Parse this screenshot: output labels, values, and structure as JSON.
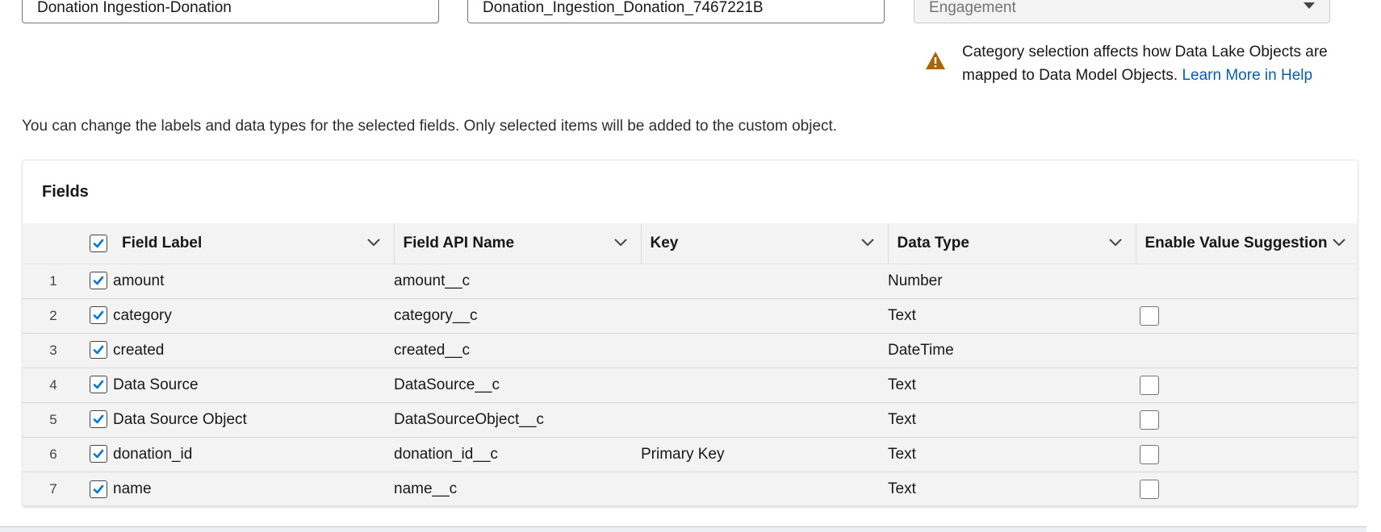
{
  "form": {
    "object_label_value": "Donation Ingestion-Donation",
    "object_api_name_value": "Donation_Ingestion_Donation_7467221B",
    "category_value": "Engagement"
  },
  "warning": {
    "text": "Category selection affects how Data Lake Objects are mapped to Data Model Objects.",
    "link": "Learn More in Help"
  },
  "info_text": "You can change the labels and data types for the selected fields. Only selected items will be added to the custom object.",
  "fields_card": {
    "title": "Fields",
    "columns": [
      "Field Label",
      "Field API Name",
      "Key",
      "Data Type",
      "Enable Value Suggestion"
    ],
    "select_all_checked": true,
    "rows": [
      {
        "num": "1",
        "checked": true,
        "label": "amount",
        "api": "amount__c",
        "key": "",
        "type": "Number",
        "suggestion": null
      },
      {
        "num": "2",
        "checked": true,
        "label": "category",
        "api": "category__c",
        "key": "",
        "type": "Text",
        "suggestion": false
      },
      {
        "num": "3",
        "checked": true,
        "label": "created",
        "api": "created__c",
        "key": "",
        "type": "DateTime",
        "suggestion": null
      },
      {
        "num": "4",
        "checked": true,
        "label": "Data Source",
        "api": "DataSource__c",
        "key": "",
        "type": "Text",
        "suggestion": false
      },
      {
        "num": "5",
        "checked": true,
        "label": "Data Source Object",
        "api": "DataSourceObject__c",
        "key": "",
        "type": "Text",
        "suggestion": false
      },
      {
        "num": "6",
        "checked": true,
        "label": "donation_id",
        "api": "donation_id__c",
        "key": "Primary Key",
        "type": "Text",
        "suggestion": false
      },
      {
        "num": "7",
        "checked": true,
        "label": "name",
        "api": "name__c",
        "key": "",
        "type": "Text",
        "suggestion": false
      }
    ]
  },
  "colors": {
    "accent": "#0176d3",
    "link": "#0b5cab",
    "warning": "#a96404",
    "header_bg": "#f3f3f3"
  },
  "icons": {
    "warning": "warning-icon",
    "column_menu": "chevron-down-icon",
    "checkbox_tick": "check-icon",
    "select_caret": "caret-down-icon"
  }
}
